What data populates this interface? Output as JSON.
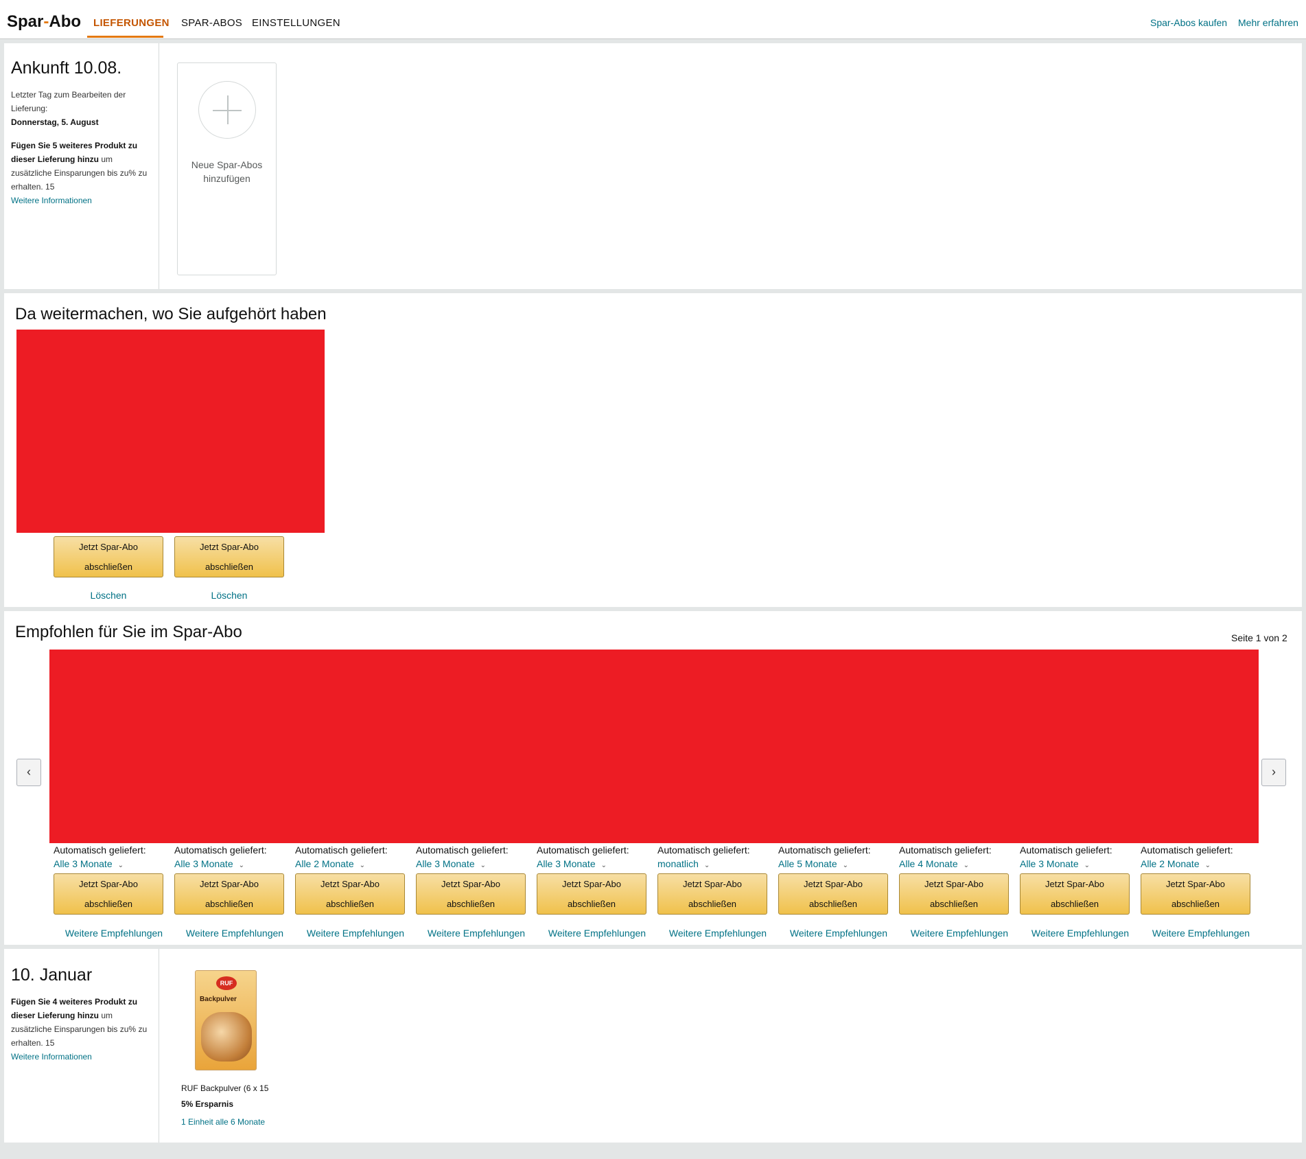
{
  "header": {
    "brand_left": "Spar",
    "brand_dash": "-",
    "brand_right": "Abo",
    "tabs": [
      {
        "label": "LIEFERUNGEN",
        "active": true
      },
      {
        "label": "SPAR-ABOS",
        "active": false
      },
      {
        "label": "EINSTELLUNGEN",
        "active": false
      }
    ],
    "links": [
      "Spar-Abos kaufen",
      "Mehr erfahren"
    ]
  },
  "delivery1": {
    "title": "Ankunft 10.08.",
    "last_day_label": "Letzter Tag zum Bearbeiten der Lieferung:",
    "last_day_value": "Donnerstag, 5. August",
    "add_bold": "Fügen Sie 5 weiteres Produkt zu dieser Lieferung hinzu",
    "add_rest": " um zusätzliche Einsparungen bis zu% zu erhalten. 15",
    "more_info": "Weitere Informationen",
    "add_card_label": "Neue Spar-Abos hinzufügen"
  },
  "continue": {
    "title": "Da weitermachen, wo Sie aufgehört haben",
    "items": [
      {
        "button_line1": "Jetzt Spar-Abo",
        "button_line2": "abschließen",
        "delete": "Löschen"
      },
      {
        "button_line1": "Jetzt Spar-Abo",
        "button_line2": "abschließen",
        "delete": "Löschen"
      }
    ]
  },
  "recommended": {
    "title": "Empfohlen für Sie im Spar-Abo",
    "page_info": "Seite 1 von 2",
    "prev_icon": "chevron-left-icon",
    "next_icon": "chevron-right-icon",
    "auto_label": "Automatisch geliefert:",
    "button_line1": "Jetzt Spar-Abo",
    "button_line2": "abschließen",
    "more": "Weitere Empfehlungen",
    "frequencies": [
      "Alle 3 Monate",
      "Alle 3 Monate",
      "Alle 2 Monate",
      "Alle 3 Monate",
      "Alle 3 Monate",
      "monatlich",
      "Alle 5 Monate",
      "Alle 4 Monate",
      "Alle 3 Monate",
      "Alle 2 Monate"
    ]
  },
  "delivery2": {
    "title": "10. Januar",
    "add_bold": "Fügen Sie 4 weiteres Produkt zu dieser Lieferung hinzu",
    "add_rest": " um zusätzliche Einsparungen bis zu% zu erhalten. 15",
    "more_info": "Weitere Informationen",
    "product": {
      "image_logo": "RUF",
      "image_label": "Backpulver",
      "name": "RUF Backpulver (6 x 15",
      "savings": "5% Ersparnis",
      "frequency": "1 Einheit alle 6 Monate"
    }
  },
  "colors": {
    "accent": "#e47911",
    "link": "#007185",
    "button": "#f0c14b",
    "redacted": "#ed1c24"
  }
}
